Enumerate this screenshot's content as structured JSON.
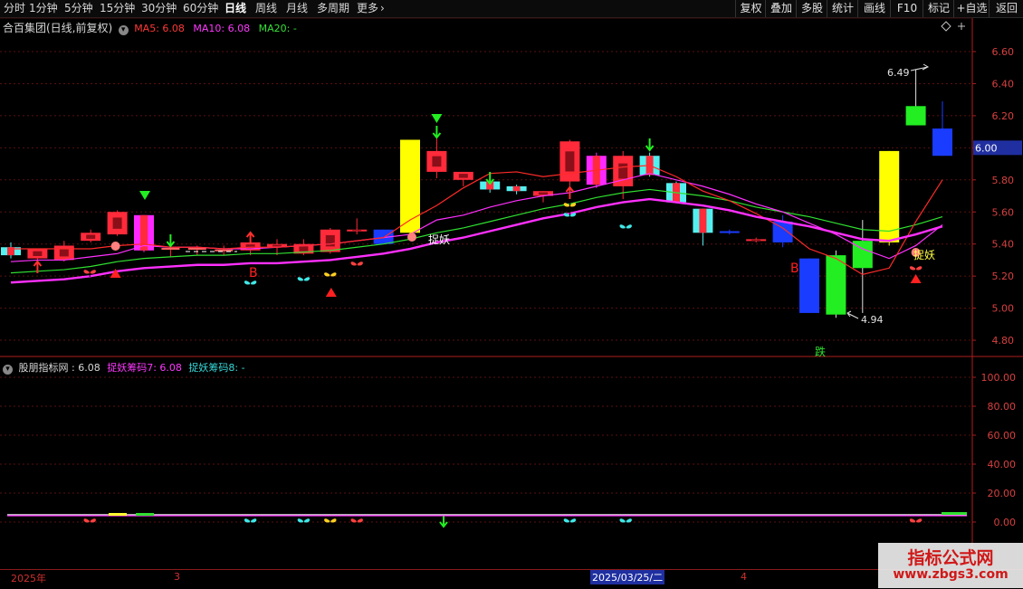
{
  "toolbar": {
    "tabs": [
      "分时",
      "1分钟",
      "5分钟",
      "15分钟",
      "30分钟",
      "60分钟",
      "日线",
      "周线",
      "月线",
      "多周期",
      "更多"
    ],
    "active_tab": "日线",
    "right_buttons": [
      "复权",
      "叠加",
      "多股",
      "统计",
      "画线",
      "F10",
      "标记",
      "+自选",
      "返回"
    ]
  },
  "main_legend": {
    "title": "合百集团(日线,前复权)",
    "ma5": "MA5: 6.08",
    "ma10": "MA10: 6.08",
    "ma20": "MA20: -"
  },
  "sub_legend": {
    "title": "股朋指标网 : 6.08",
    "item1": "捉妖筹码7: 6.08",
    "item2": "捉妖筹码8: -"
  },
  "price_axis": [
    "6.60",
    "6.40",
    "6.20",
    "6.00",
    "5.80",
    "5.60",
    "5.40",
    "5.20",
    "5.00",
    "4.80"
  ],
  "sub_axis": [
    "100.00",
    "80.00",
    "60.00",
    "40.00",
    "20.00",
    "0.00"
  ],
  "current_price_tag": "6.00",
  "annotations": {
    "high": "6.49",
    "low": "4.94",
    "zy1": "捉妖",
    "zy2": "捉妖",
    "b1": "B",
    "b2": "B",
    "die": "跌"
  },
  "date_axis": {
    "year": "2025年",
    "march": "3",
    "cursor_date": "2025/03/25/二",
    "april": "4"
  },
  "watermark": {
    "line1": "指标公式网",
    "line2": "www.zbgs3.com"
  },
  "colors": {
    "up": "#ff2a3a",
    "down_cyan": "#54f0f0",
    "blue": "#1a3cff",
    "yellow": "#ffff00",
    "green": "#22ee22",
    "magenta": "#ff28ff",
    "ma5": "#ff2a2a",
    "ma10": "#ff30ff",
    "ma20": "#30e030"
  },
  "chart_data": {
    "type": "candlestick",
    "y_range": [
      4.75,
      6.68
    ],
    "candles": [
      {
        "o": 5.38,
        "h": 5.41,
        "l": 5.31,
        "c": 5.33,
        "style": "cyan"
      },
      {
        "o": 5.31,
        "h": 5.36,
        "l": 5.26,
        "c": 5.37,
        "style": "red"
      },
      {
        "o": 5.3,
        "h": 5.42,
        "l": 5.29,
        "c": 5.39,
        "style": "red"
      },
      {
        "o": 5.42,
        "h": 5.49,
        "l": 5.41,
        "c": 5.47,
        "style": "red"
      },
      {
        "o": 5.46,
        "h": 5.61,
        "l": 5.45,
        "c": 5.6,
        "style": "red"
      },
      {
        "o": 5.58,
        "h": 5.58,
        "l": 5.35,
        "c": 5.36,
        "style": "magenta"
      },
      {
        "o": 5.37,
        "h": 5.39,
        "l": 5.32,
        "c": 5.37,
        "style": "doji"
      },
      {
        "o": 5.37,
        "h": 5.39,
        "l": 5.33,
        "c": 5.36,
        "style": "doji"
      },
      {
        "o": 5.36,
        "h": 5.39,
        "l": 5.33,
        "c": 5.36,
        "style": "doji"
      },
      {
        "o": 5.36,
        "h": 5.42,
        "l": 5.33,
        "c": 5.41,
        "style": "red"
      },
      {
        "o": 5.38,
        "h": 5.43,
        "l": 5.33,
        "c": 5.4,
        "style": "red"
      },
      {
        "o": 5.34,
        "h": 5.43,
        "l": 5.33,
        "c": 5.4,
        "style": "red"
      },
      {
        "o": 5.35,
        "h": 5.5,
        "l": 5.34,
        "c": 5.49,
        "style": "red"
      },
      {
        "o": 5.48,
        "h": 5.56,
        "l": 5.46,
        "c": 5.49,
        "style": "red"
      },
      {
        "o": 5.49,
        "h": 5.49,
        "l": 5.4,
        "c": 5.4,
        "style": "blue"
      },
      {
        "o": 5.47,
        "h": 6.05,
        "l": 5.45,
        "c": 6.05,
        "style": "yellow"
      },
      {
        "o": 5.98,
        "h": 6.06,
        "l": 5.81,
        "c": 5.85,
        "style": "red"
      },
      {
        "o": 5.8,
        "h": 5.84,
        "l": 5.76,
        "c": 5.85,
        "style": "red"
      },
      {
        "o": 5.79,
        "h": 5.83,
        "l": 5.72,
        "c": 5.74,
        "style": "cyan"
      },
      {
        "o": 5.76,
        "h": 5.77,
        "l": 5.71,
        "c": 5.73,
        "style": "cyan"
      },
      {
        "o": 5.7,
        "h": 5.73,
        "l": 5.66,
        "c": 5.73,
        "style": "red"
      },
      {
        "o": 6.04,
        "h": 6.05,
        "l": 5.76,
        "c": 5.79,
        "style": "red"
      },
      {
        "o": 5.77,
        "h": 5.97,
        "l": 5.75,
        "c": 5.95,
        "style": "magenta"
      },
      {
        "o": 5.95,
        "h": 5.98,
        "l": 5.68,
        "c": 5.76,
        "style": "red"
      },
      {
        "o": 5.95,
        "h": 5.97,
        "l": 5.82,
        "c": 5.83,
        "style": "cyan"
      },
      {
        "o": 5.78,
        "h": 5.79,
        "l": 5.66,
        "c": 5.66,
        "style": "cyan"
      },
      {
        "o": 5.62,
        "h": 5.62,
        "l": 5.39,
        "c": 5.47,
        "style": "cyan"
      },
      {
        "o": 5.48,
        "h": 5.49,
        "l": 5.46,
        "c": 5.47,
        "style": "blue"
      },
      {
        "o": 5.43,
        "h": 5.44,
        "l": 5.41,
        "c": 5.42,
        "style": "red"
      },
      {
        "o": 5.54,
        "h": 5.58,
        "l": 5.38,
        "c": 5.41,
        "style": "blue"
      },
      {
        "o": 5.31,
        "h": 5.31,
        "l": 4.97,
        "c": 4.97,
        "style": "blue"
      },
      {
        "o": 4.96,
        "h": 5.36,
        "l": 4.94,
        "c": 5.33,
        "style": "green"
      },
      {
        "o": 5.25,
        "h": 5.55,
        "l": 4.97,
        "c": 5.42,
        "style": "green"
      },
      {
        "o": 5.41,
        "h": 5.98,
        "l": 5.39,
        "c": 5.98,
        "style": "yellow"
      },
      {
        "o": 6.14,
        "h": 6.49,
        "l": 6.14,
        "c": 6.26,
        "style": "green"
      },
      {
        "o": 6.12,
        "h": 6.29,
        "l": 5.95,
        "c": 5.95,
        "style": "blue"
      }
    ],
    "ma5": [
      5.37,
      5.37,
      5.37,
      5.37,
      5.39,
      5.4,
      5.38,
      5.38,
      5.37,
      5.38,
      5.38,
      5.39,
      5.4,
      5.42,
      5.44,
      5.55,
      5.64,
      5.75,
      5.84,
      5.85,
      5.82,
      5.84,
      5.86,
      5.88,
      5.89,
      5.82,
      5.73,
      5.67,
      5.59,
      5.5,
      5.37,
      5.31,
      5.21,
      5.25,
      5.54,
      5.8
    ],
    "ma10": [
      5.29,
      5.3,
      5.3,
      5.32,
      5.34,
      5.39,
      5.38,
      5.38,
      5.37,
      5.37,
      5.38,
      5.39,
      5.4,
      5.42,
      5.44,
      5.46,
      5.55,
      5.58,
      5.63,
      5.67,
      5.7,
      5.72,
      5.76,
      5.8,
      5.84,
      5.8,
      5.76,
      5.71,
      5.65,
      5.6,
      5.53,
      5.46,
      5.37,
      5.31,
      5.39,
      5.52
    ],
    "ma20": [
      5.22,
      5.23,
      5.24,
      5.26,
      5.29,
      5.31,
      5.32,
      5.33,
      5.33,
      5.34,
      5.34,
      5.35,
      5.36,
      5.38,
      5.4,
      5.43,
      5.47,
      5.5,
      5.54,
      5.58,
      5.62,
      5.65,
      5.69,
      5.72,
      5.74,
      5.72,
      5.7,
      5.67,
      5.63,
      5.6,
      5.57,
      5.53,
      5.49,
      5.48,
      5.52,
      5.57
    ]
  }
}
